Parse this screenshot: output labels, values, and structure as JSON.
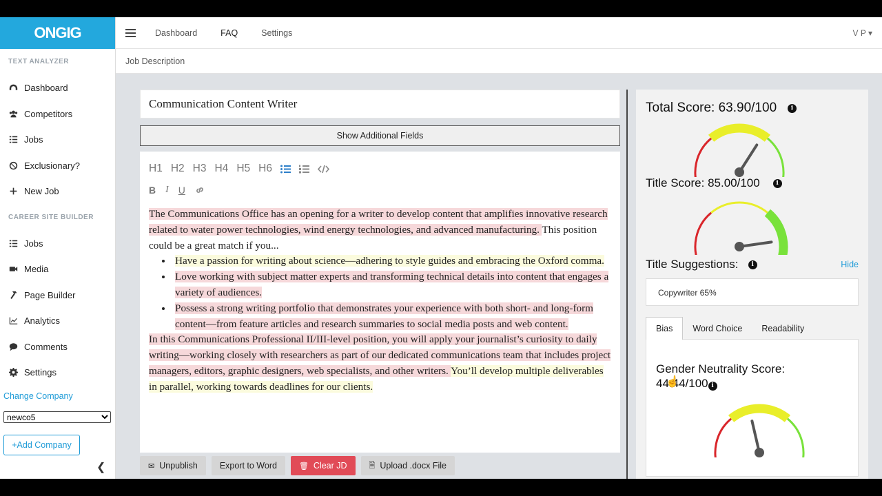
{
  "app": {
    "logo": "ONGIG"
  },
  "sidebar": {
    "section1": "TEXT ANALYZER",
    "items1": [
      {
        "label": "Dashboard",
        "icon": "dashboard-icon"
      },
      {
        "label": "Competitors",
        "icon": "users-icon"
      },
      {
        "label": "Jobs",
        "icon": "list-icon"
      },
      {
        "label": "Exclusionary?",
        "icon": "ban-icon"
      },
      {
        "label": "New Job",
        "icon": "plus-icon"
      }
    ],
    "section2": "CAREER SITE BUILDER",
    "items2": [
      {
        "label": "Jobs",
        "icon": "list-icon"
      },
      {
        "label": "Media",
        "icon": "video-icon"
      },
      {
        "label": "Page Builder",
        "icon": "hammer-icon"
      },
      {
        "label": "Analytics",
        "icon": "chart-icon"
      },
      {
        "label": "Comments",
        "icon": "comment-icon"
      },
      {
        "label": "Settings",
        "icon": "gear-icon"
      }
    ],
    "change_company": "Change Company",
    "company_selected": "newco5",
    "add_company": "+Add Company"
  },
  "topbar": {
    "nav": [
      "Dashboard",
      "FAQ",
      "Settings"
    ],
    "user": "V P"
  },
  "breadcrumb": "Job Description",
  "editor": {
    "job_title": "Communication Content Writer",
    "show_fields": "Show Additional Fields",
    "toolbar_headings": [
      "H1",
      "H2",
      "H3",
      "H4",
      "H5",
      "H6"
    ],
    "para1_highlight": " The Communications Office has an opening for a writer to develop content that amplifies innovative research related to water power technologies, wind energy technologies, and advanced manufacturing. ",
    "para1_rest": " This position could be a great match if you...",
    "bullets": [
      {
        "text": " Have a passion for writing about science—adhering to style guides and embracing the Oxford comma. ",
        "tone": "yellow"
      },
      {
        "text": " Love working with subject matter experts and transforming technical details into content that engages a variety of audiences. ",
        "tone": "pink"
      },
      {
        "text": " Possess a strong writing portfolio that demonstrates your experience with both short- and long-form content—from feature articles and research summaries to social media posts and web content. ",
        "tone": "pink"
      }
    ],
    "para2_highlight": " In this Communications Professional II/III-level position, you will apply your journalist’s curiosity to daily writing—working closely with researchers as part of our dedicated communications team that includes project managers, editors, graphic designers, web specialists, and other writers. ",
    "para2_rest": " You’ll develop multiple deliverables in parallel, working towards deadlines for our clients. "
  },
  "buttons": {
    "unpublish": "Unpublish",
    "export": "Export to Word",
    "clear": "Clear JD",
    "upload": "Upload .docx File"
  },
  "scores": {
    "total_label": "Total Score: 63.90/100",
    "total": 63.9,
    "title_label": "Title Score: 85.00/100",
    "title": 85.0,
    "suggestions_label": "Title Suggestions:",
    "hide": "Hide",
    "suggestion": "Copywriter 65%",
    "tabs": [
      "Bias",
      "Word Choice",
      "Readability"
    ],
    "gender_label_1": "Gender Neutrality Score:",
    "gender_label_2": "44.44/100",
    "gender": 44.44
  },
  "colors": {
    "brand": "#23a8dd",
    "danger": "#e14b57",
    "gauge_red": "#d9262b",
    "gauge_yellow": "#e9ee2a",
    "gauge_green": "#79e23b"
  }
}
